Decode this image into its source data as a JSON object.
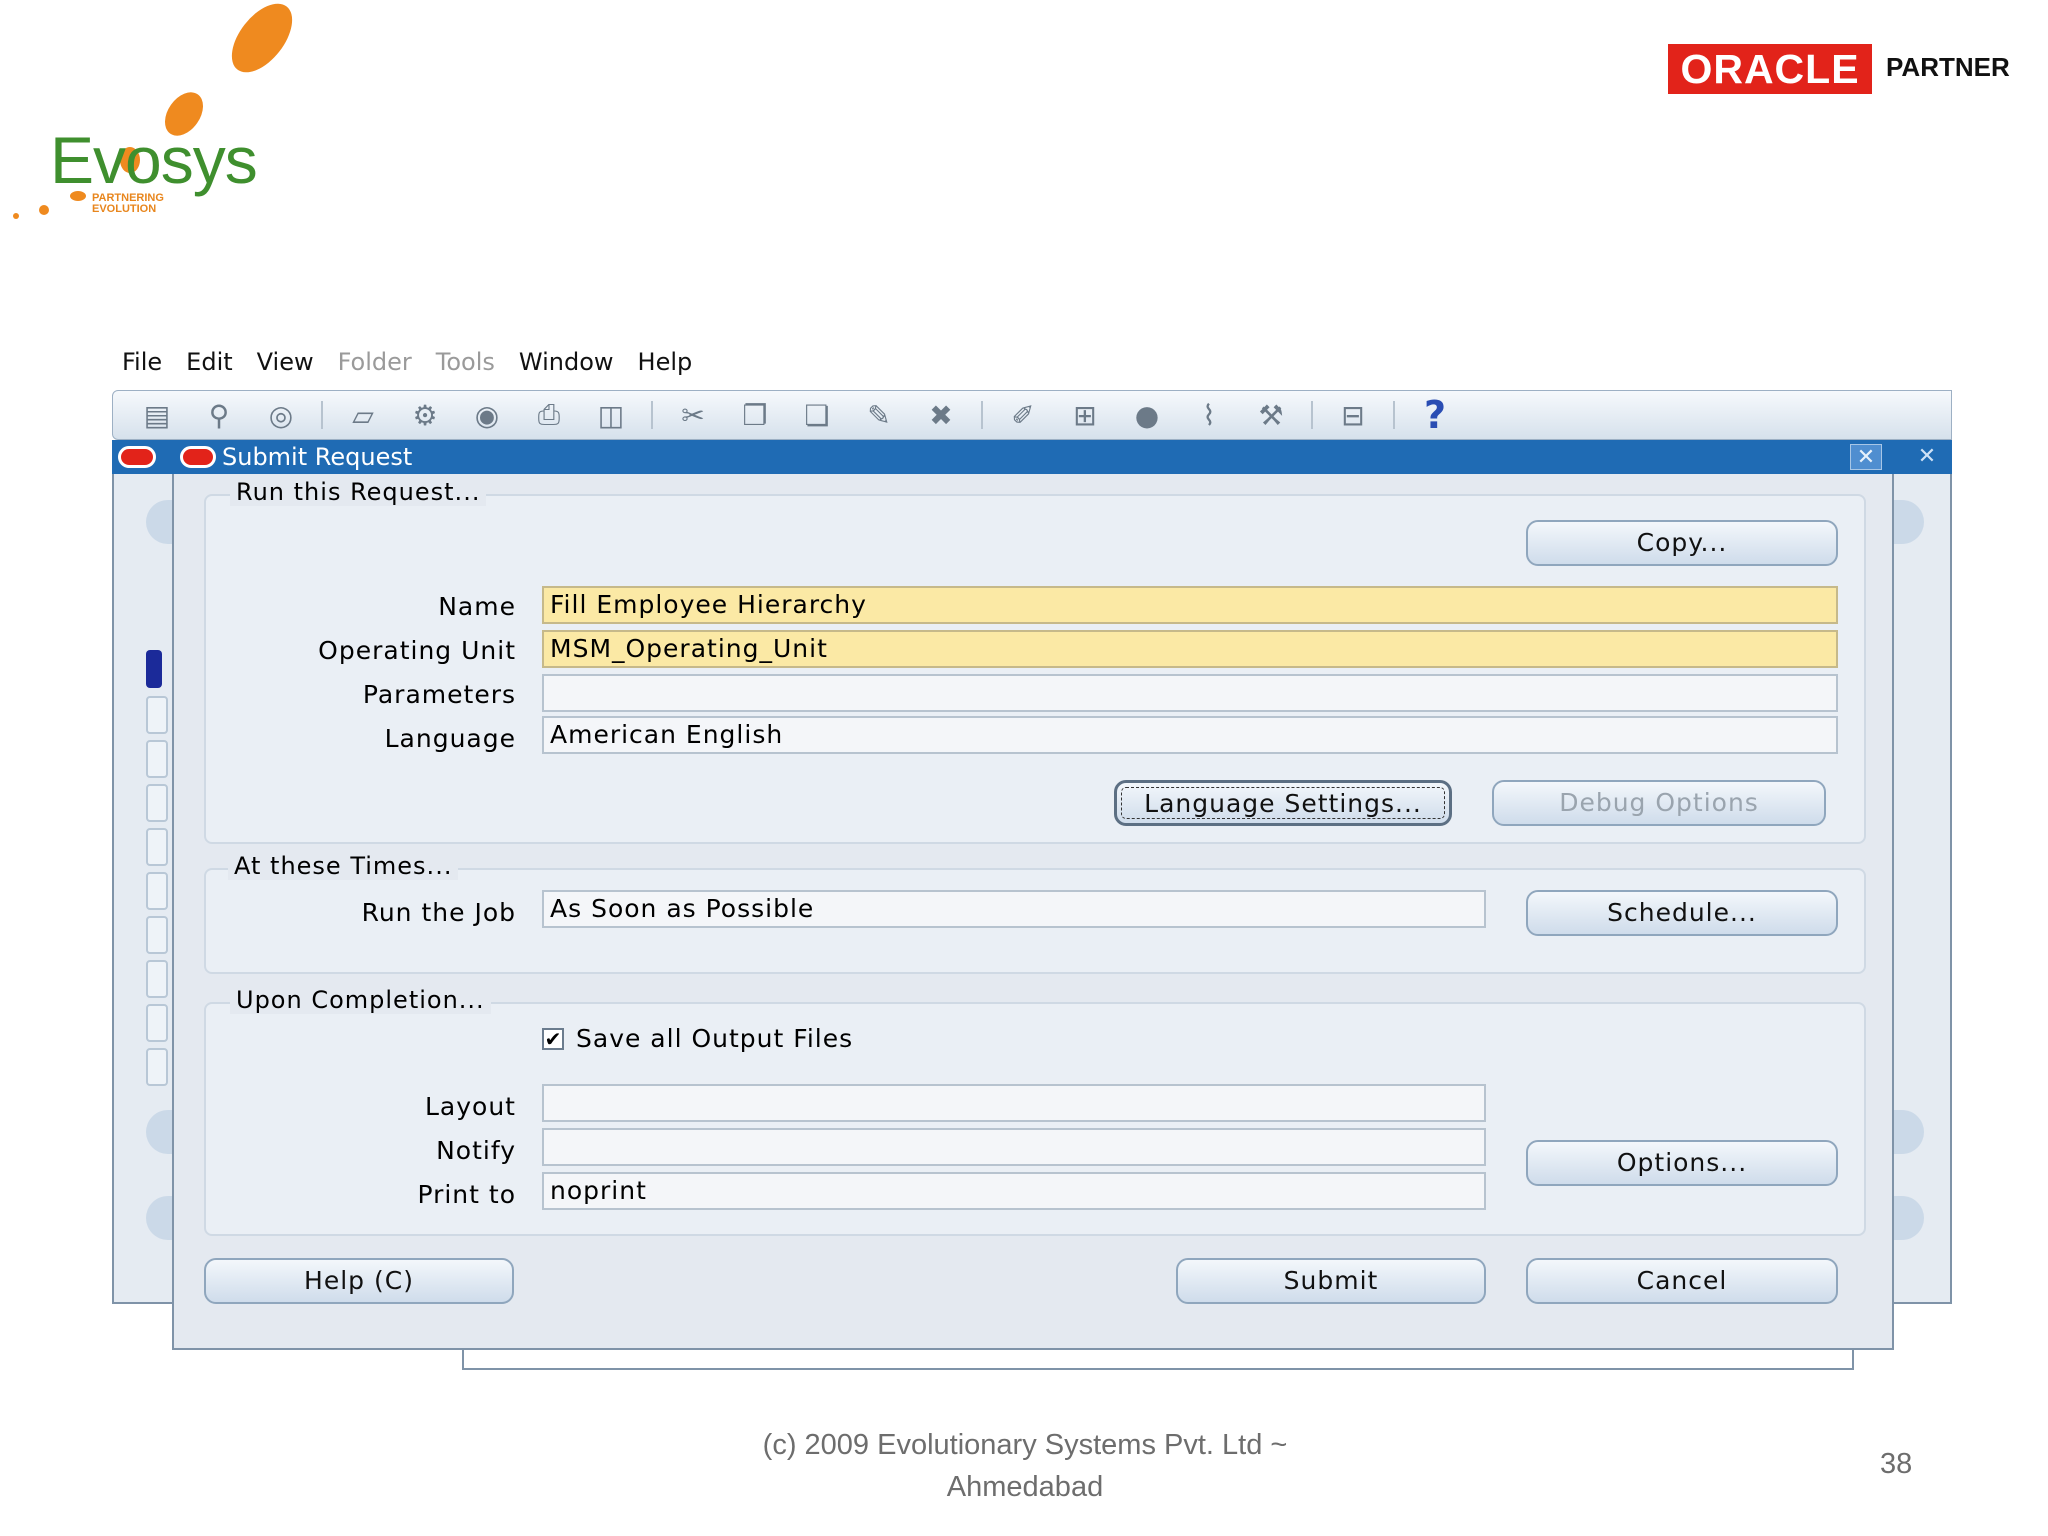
{
  "branding": {
    "evosys_name": "Evosys",
    "evosys_tagline": "PARTNERING EVOLUTION",
    "oracle_badge": "ORACLE",
    "oracle_partner": "PARTNER"
  },
  "menubar": {
    "items": [
      {
        "label": "File",
        "enabled": true
      },
      {
        "label": "Edit",
        "enabled": true
      },
      {
        "label": "View",
        "enabled": true
      },
      {
        "label": "Folder",
        "enabled": false
      },
      {
        "label": "Tools",
        "enabled": false
      },
      {
        "label": "Window",
        "enabled": true
      },
      {
        "label": "Help",
        "enabled": true
      }
    ]
  },
  "toolbar": {
    "icons": [
      "new-record-icon",
      "find-icon",
      "navigator-icon",
      "save-icon",
      "next-step-icon",
      "switch-responsibility-icon",
      "print-icon",
      "close-form-icon",
      "cut-icon",
      "copy-icon",
      "paste-icon",
      "clear-record-icon",
      "delete-record-icon",
      "edit-field-icon",
      "zoom-icon",
      "translations-icon",
      "attachments-icon",
      "folder-tools-icon",
      "window-help-icon"
    ],
    "help_symbol": "?"
  },
  "dialog": {
    "title": "Submit Request",
    "run_group": {
      "label": "Run this Request...",
      "copy_button": "Copy...",
      "name_label": "Name",
      "name_value": "Fill Employee Hierarchy",
      "operating_unit_label": "Operating Unit",
      "operating_unit_value": "MSM_Operating_Unit",
      "parameters_label": "Parameters",
      "parameters_value": "",
      "language_label": "Language",
      "language_value": "American English",
      "language_settings_button": "Language Settings...",
      "debug_options_button": "Debug Options"
    },
    "times_group": {
      "label": "At these Times...",
      "run_job_label": "Run the Job",
      "run_job_value": "As Soon as Possible",
      "schedule_button": "Schedule..."
    },
    "completion_group": {
      "label": "Upon Completion...",
      "save_output_label": "Save all Output Files",
      "save_output_checked": true,
      "checkbox_mark": "✔",
      "layout_label": "Layout",
      "layout_value": "",
      "notify_label": "Notify",
      "notify_value": "",
      "print_to_label": "Print to",
      "print_to_value": "noprint",
      "options_button": "Options..."
    },
    "help_button": "Help (C)",
    "submit_button": "Submit",
    "cancel_button": "Cancel"
  },
  "footer": {
    "copyright": "(c) 2009 Evolutionary Systems Pvt. Ltd ~ Ahmedabad",
    "page_number": "38"
  },
  "colors": {
    "titlebar": "#1f6bb4",
    "required_field": "#fbe9a5",
    "oracle_red": "#e2231a",
    "evosys_green": "#3f8f2e",
    "evosys_orange": "#ef8a1f"
  }
}
